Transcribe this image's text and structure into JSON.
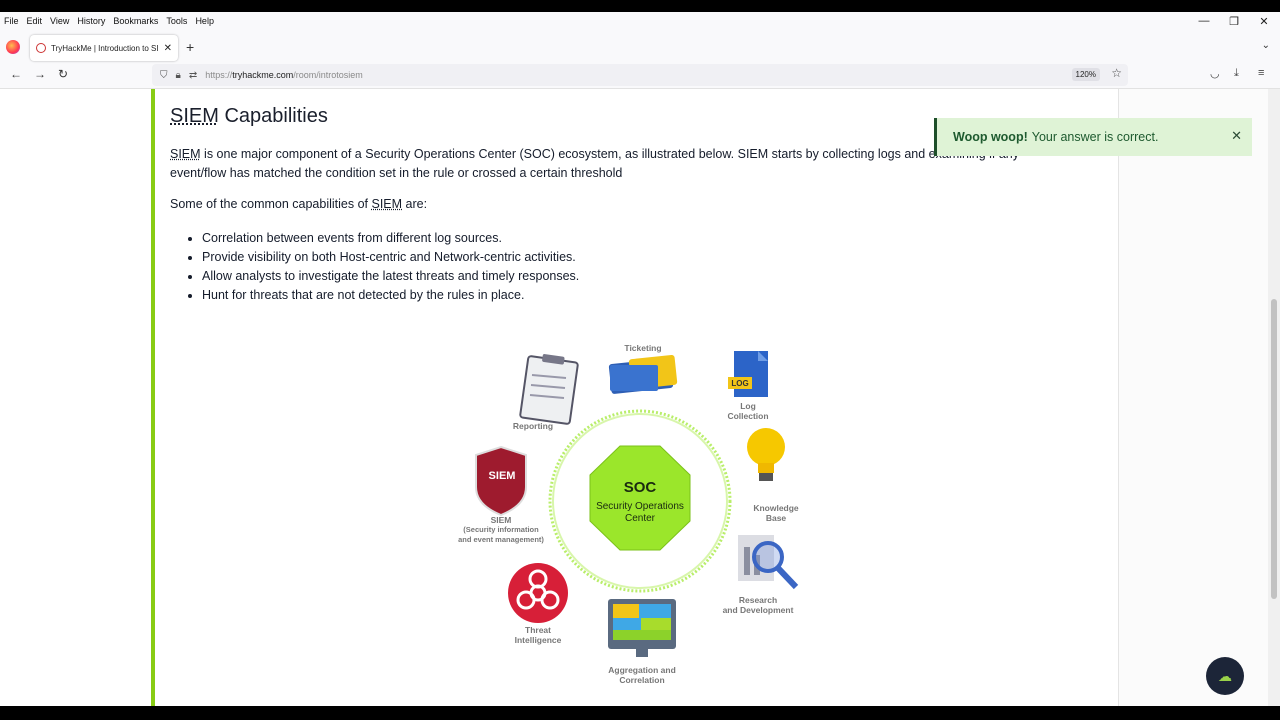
{
  "menu": [
    "File",
    "Edit",
    "View",
    "History",
    "Bookmarks",
    "Tools",
    "Help"
  ],
  "window_controls": {
    "minimize": "—",
    "restore": "❐",
    "close": "✕"
  },
  "tab": {
    "label": "TryHackMe | Introduction to SI",
    "close": "✕",
    "new": "+",
    "list": "⌄"
  },
  "nav": {
    "back": "←",
    "forward": "→",
    "reload": "↻"
  },
  "url": {
    "prefix": "https://",
    "host": "tryhackme.com",
    "path": "/room/introtosiem",
    "zoom": "120%"
  },
  "page": {
    "heading_abbr": "SIEM",
    "heading_rest": " Capabilities",
    "para1_abbr": "SIEM",
    "para1_rest": " is one major component of a Security Operations Center (SOC) ecosystem, as illustrated below. SIEM starts by collecting logs and examining if any event/flow has matched the condition set in the rule or crossed a certain threshold",
    "para2_start": "Some of the common capabilities of ",
    "para2_abbr": "SIEM",
    "para2_end": " are:",
    "bullets": [
      "Correlation between events from different log sources.",
      "Provide visibility on both Host-centric and Network-centric activities.",
      "Allow analysts to investigate the latest threats and timely responses.",
      "Hunt for threats that are not detected by the rules in place."
    ]
  },
  "diagram": {
    "center_title": "SOC",
    "center_line1": "Security Operations",
    "center_line2": "Center",
    "siem_badge": "SIEM",
    "log_badge": "LOG",
    "labels": {
      "ticketing": "Ticketing",
      "reporting": "Reporting",
      "log1": "Log",
      "log2": "Collection",
      "kb1": "Knowledge",
      "kb2": "Base",
      "siem1": "SIEM",
      "siem2": "(Security information",
      "siem3": "and event management)",
      "rd1": "Research",
      "rd2": "and Development",
      "ti1": "Threat",
      "ti2": "Intelligence",
      "ag1": "Aggregation and",
      "ag2": "Correlation"
    }
  },
  "toast": {
    "bold": "Woop woop!",
    "text": "Your answer is correct.",
    "close": "✕"
  },
  "colors": {
    "accent_green": "#88cc14",
    "toast_bg": "#dff3d6",
    "soc_green": "#9be62b",
    "siem_red": "#9e1b2e"
  }
}
